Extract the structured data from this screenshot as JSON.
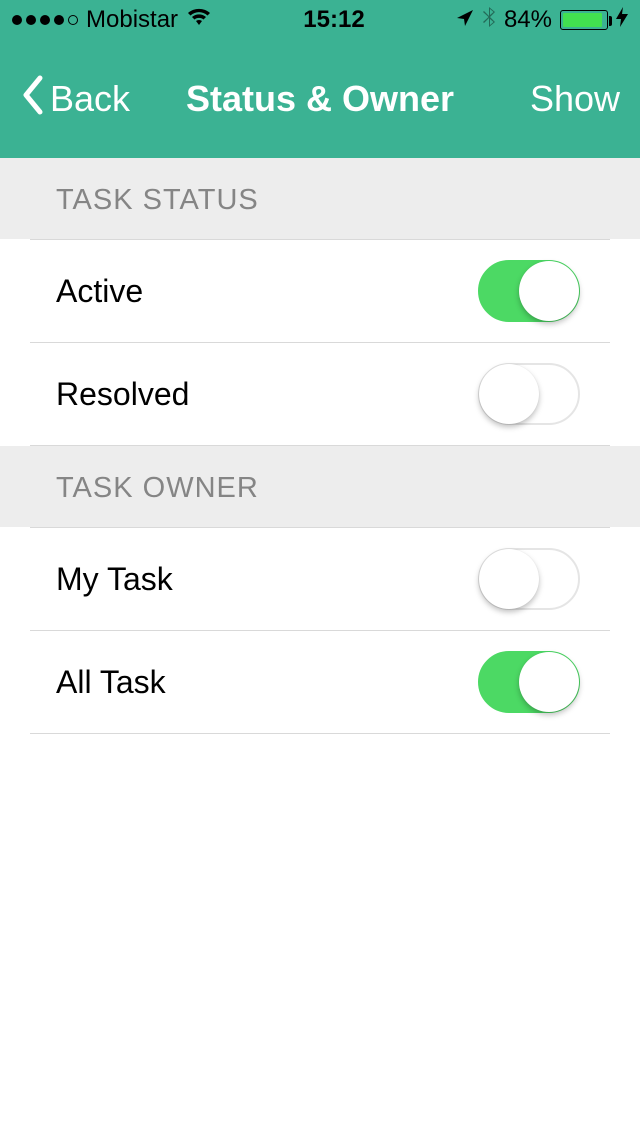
{
  "status_bar": {
    "carrier": "Mobistar",
    "time": "15:12",
    "battery_pct": "84%",
    "battery_fill_pct": 84
  },
  "nav": {
    "back_label": "Back",
    "title": "Status & Owner",
    "action_label": "Show"
  },
  "sections": {
    "task_status": {
      "header": "TASK STATUS",
      "items": [
        {
          "label": "Active",
          "on": true
        },
        {
          "label": "Resolved",
          "on": false
        }
      ]
    },
    "task_owner": {
      "header": "TASK OWNER",
      "items": [
        {
          "label": "My Task",
          "on": false
        },
        {
          "label": "All Task",
          "on": true
        }
      ]
    }
  }
}
